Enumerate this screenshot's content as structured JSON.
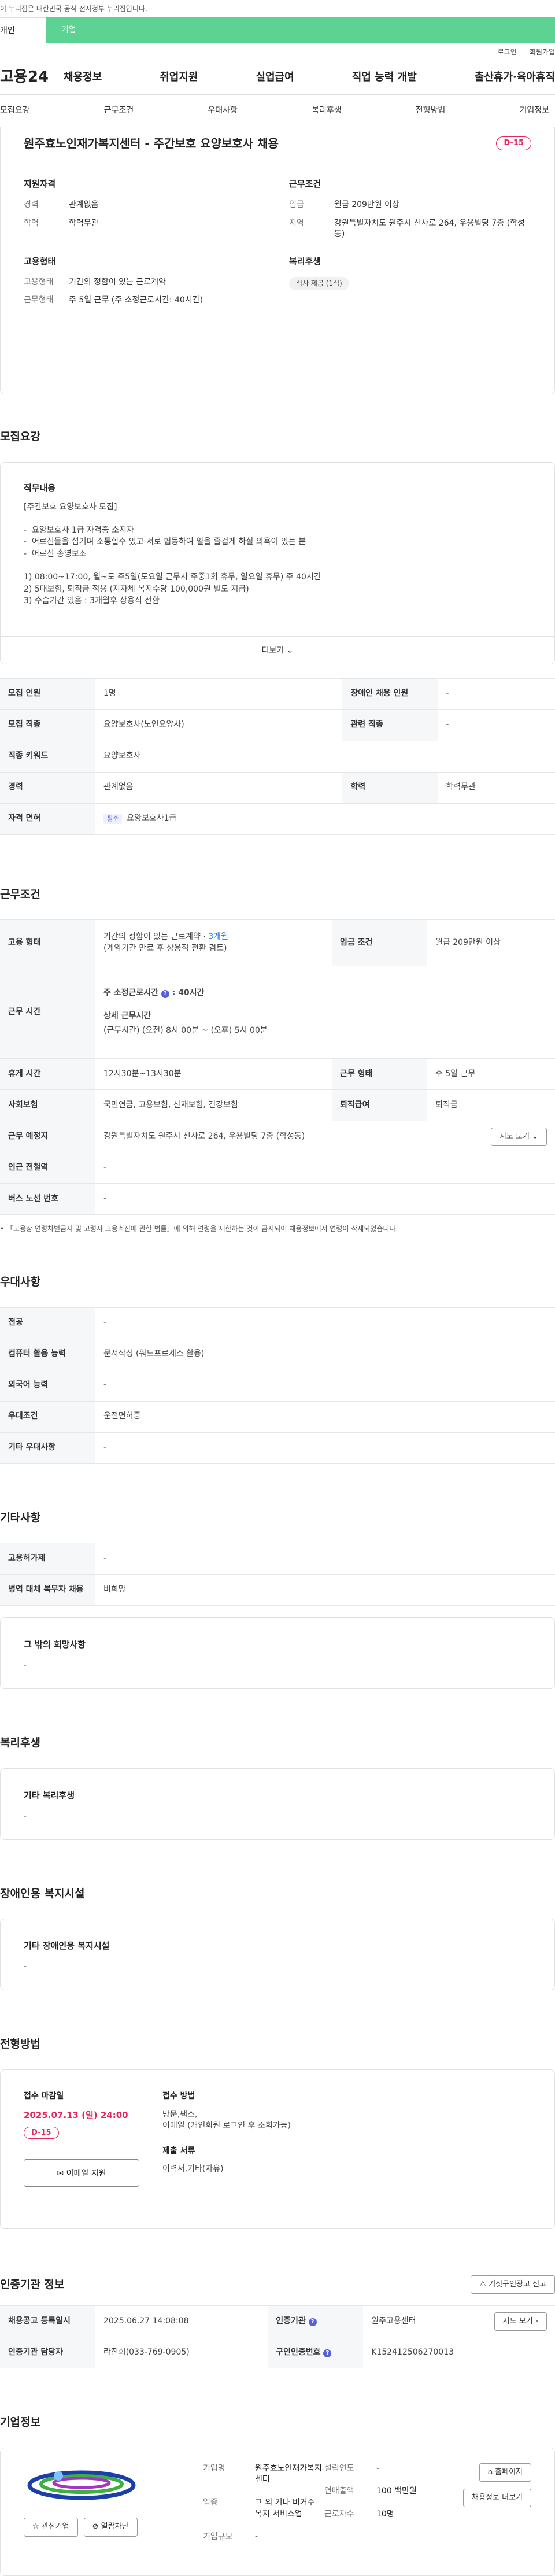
{
  "notice": "이 누리집은 대한민국 공식 전자정부 누리집입니다.",
  "tabs": {
    "individual": "개인",
    "company": "기업"
  },
  "util": {
    "login": "로그인",
    "signup": "회원가입"
  },
  "logo": "고용24",
  "gnb": [
    "채용정보",
    "취업지원",
    "실업급여",
    "직업 능력 개발",
    "출산휴가·육아휴직"
  ],
  "subnav": [
    "모집요강",
    "근무조건",
    "우대사항",
    "복리후생",
    "전형방법",
    "기업정보"
  ],
  "title": "원주효노인재가복지센터 - 주간보호 요양보호사 채용",
  "dday": "D-15",
  "summary": {
    "qual_title": "지원자격",
    "career_k": "경력",
    "career_v": "관계없음",
    "edu_k": "학력",
    "edu_v": "학력무관",
    "cond_title": "근무조건",
    "wage_k": "임금",
    "wage_v": "월급 209만원 이상",
    "region_k": "지역",
    "region_v": "강원특별자치도 원주시 천사로 264, 우용빌딩 7층 (학성동)",
    "emp_title": "고용형태",
    "emptype_k": "고용형태",
    "emptype_v": "기간의 정함이 있는 근로계약",
    "workform_k": "근무형태",
    "workform_v": "주 5일 근무 (주 소정근로시간: 40시간)",
    "welfare_title": "복리후생",
    "welfare_chip": "식사 제공 (1식)"
  },
  "s_recruit": "모집요강",
  "duty": {
    "title": "직무내용",
    "text": "[주간보호 요양보호사 모집]\n\n-  요양보호사 1급 자격증 소지자\n-  어르신들을 섬기며 소통할수 있고 서로 협동하여 일을 즐겁게 하실 의욕이 있는 분\n-  어르신 송영보조\n\n1) 08:00~17:00, 월~토 주5일(토요일 근무시 주중1회 휴무, 일요일 휴무) 주 40시간\n2) 5대보험, 퇴직금 적용 (지자체 복지수당 100,000원 별도 지급)\n3) 수습기간 있음 : 3개월후 상용직 전환",
    "more": "더보기"
  },
  "recruit_table": {
    "headcount_k": "모집 인원",
    "headcount_v": "1명",
    "disabled_k": "장애인 채용 인원",
    "disabled_v": "-",
    "job_k": "모집 직종",
    "job_v": "요양보호사(노인요양사)",
    "related_k": "관련 직종",
    "related_v": "-",
    "keyword_k": "직종 키워드",
    "keyword_v": "요양보호사",
    "career_k": "경력",
    "career_v": "관계없음",
    "edu_k": "학력",
    "edu_v": "학력무관",
    "license_k": "자격 면허",
    "license_chip": "필수",
    "license_v": "요양보호사1급"
  },
  "s_work": "근무조건",
  "work_table": {
    "emp_k": "고용 형태",
    "emp_v1": "기간의 정함이 있는 근로계약 · ",
    "emp_v1b": "3개월",
    "emp_v2": "(계약기간 만료 후 상용직 전환 검토)",
    "wage_k": "임금 조건",
    "wage_v": "월급 209만원 이상",
    "time_k": "근무 시간",
    "time_a": "주 소정근로시간",
    "time_b": ": 40시간",
    "time_c": "상세 근무시간",
    "time_d": "(근무시간) (오전) 8시 00분 ~ (오후) 5시 00분",
    "break_k": "휴게 시간",
    "break_v": "12시30분~13시30분",
    "form_k": "근무 형태",
    "form_v": "주 5일 근무",
    "ins_k": "사회보험",
    "ins_v": "국민연금, 고용보험, 산재보험, 건강보험",
    "ret_k": "퇴직급여",
    "ret_v": "퇴직금",
    "place_k": "근무 예정지",
    "place_v": "강원특별자치도 원주시 천사로 264, 우용빌딩 7층 (학성동)",
    "map_btn": "지도 보기",
    "subway_k": "인근 전철역",
    "subway_v": "-",
    "bus_k": "버스 노선 번호",
    "bus_v": "-"
  },
  "work_note": "「고용상 연령차별금지 및 고령자 고용촉진에 관한 법률」에 의해 연령을 제한하는 것이 금지되어 채용정보에서 연령이 삭제되었습니다.",
  "s_pref": "우대사항",
  "pref_table": {
    "major_k": "전공",
    "major_v": "-",
    "pc_k": "컴퓨터 활용 능력",
    "pc_v": "문서작성 (워드프로세스 활용)",
    "lang_k": "외국어 능력",
    "lang_v": "-",
    "cond_k": "우대조건",
    "cond_v": "운전면허증",
    "etc_k": "기타 우대사항",
    "etc_v": "-"
  },
  "s_etc": "기타사항",
  "etc_table": {
    "type_k": "고용허가제",
    "type_v": "-",
    "mil_k": "병역 대체 복무자 채용",
    "mil_v": "비희망"
  },
  "etc_box": {
    "title": "그 밖의 희망사항",
    "value": "-"
  },
  "s_welfare": "복리후생",
  "welfare_box": {
    "title": "기타 복리후생",
    "value": "-"
  },
  "s_disab": "장애인용 복지시설",
  "disab_box": {
    "title": "기타 장애인용 복지시설",
    "value": "-"
  },
  "s_method": "전형방법",
  "method": {
    "deadline_k": "접수 마감일",
    "deadline_v": "2025.07.13 (일) 24:00",
    "dday": "D-15",
    "email_btn": "이메일 지원",
    "how_k": "접수 방법",
    "how_v1": "방문,팩스,",
    "how_v2": "이메일 (개인회원 로그인 후 조회가능)",
    "docs_k": "제출 서류",
    "docs_v": "이력서,기타(자유)"
  },
  "s_agency": "인증기관 정보",
  "report_btn": "거짓구인광고 신고",
  "agency_table": {
    "reg_k": "채용공고 등록일시",
    "reg_v": "2025.06.27 14:08:08",
    "org_k": "인증기관",
    "org_v": "원주고용센터",
    "map_btn": "지도 보기",
    "mgr_k": "인증기관 담당자",
    "mgr_v": "라진희(033-769-0905)",
    "num_k": "구인인증번호",
    "num_v": "K152412506270013"
  },
  "s_company": "기업정보",
  "company": {
    "interest_btn": "관심기업",
    "block_btn": "열람차단",
    "name_k": "기업명",
    "name_v": "원주효노인재가복지센터",
    "ind_k": "업종",
    "ind_v": "그 외 기타 비거주 복지 서비스업",
    "size_k": "기업규모",
    "size_v": "-",
    "est_k": "설립연도",
    "est_v": "-",
    "sales_k": "연매출액",
    "sales_v": "100 백만원",
    "emp_k": "근로자수",
    "emp_v": "10명",
    "home_btn": "홈페이지",
    "list_btn": "채용정보 더보기"
  },
  "colors": {
    "green": "#5dd393",
    "dday": "#e6265a",
    "blue": "#1f6fe0"
  }
}
